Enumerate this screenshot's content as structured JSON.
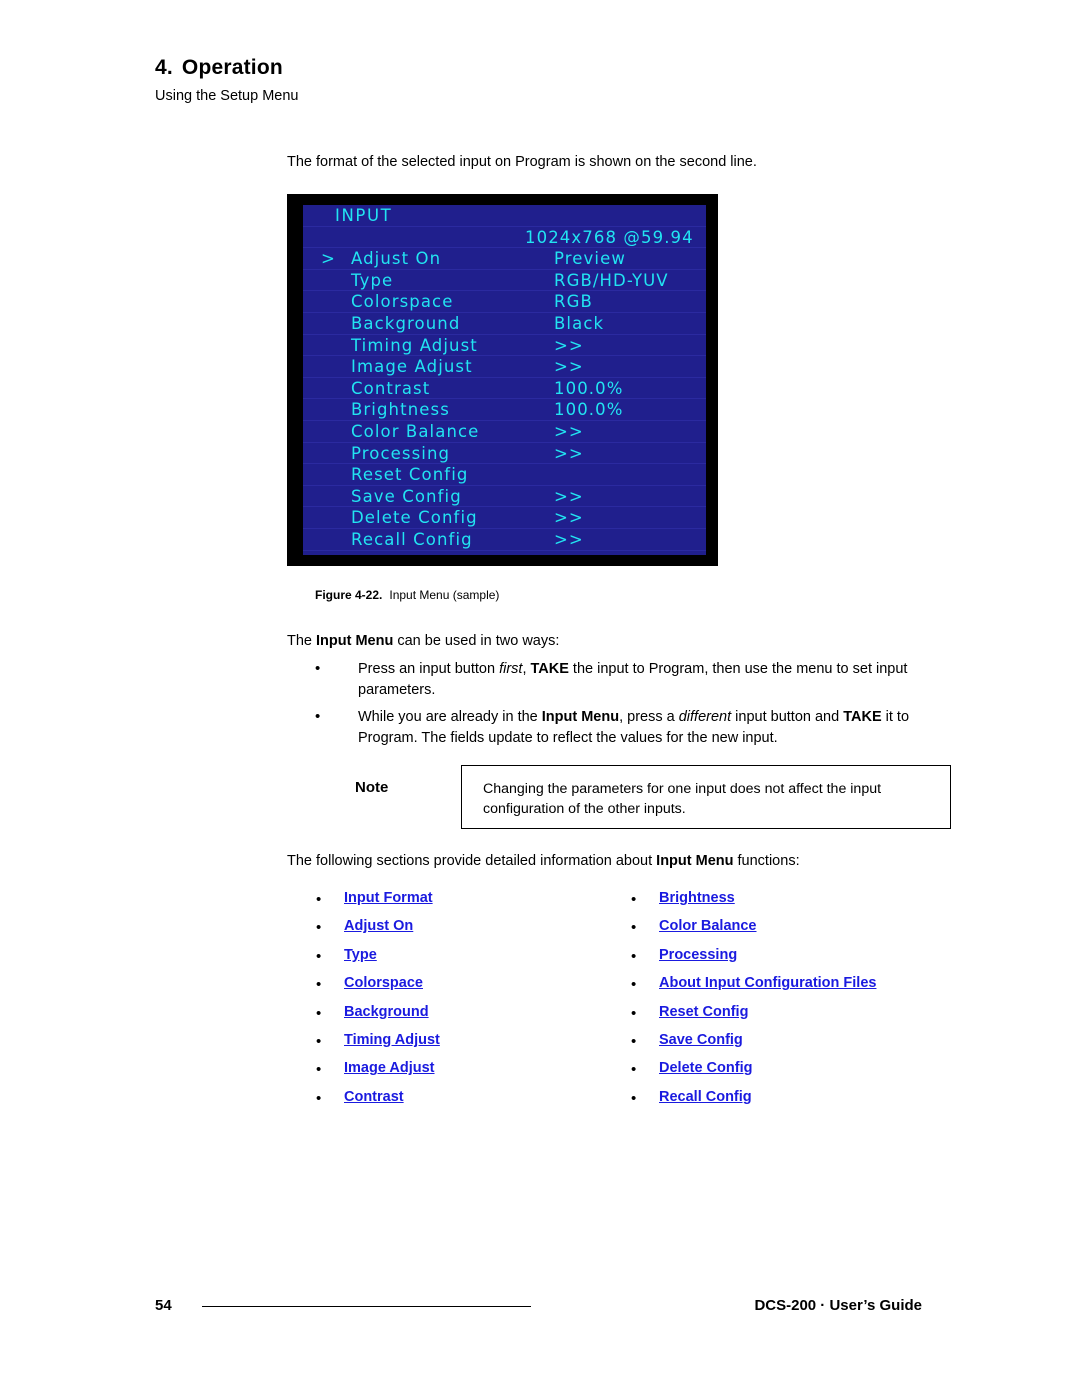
{
  "header": {
    "chapter_number": "4.",
    "chapter_title": "Operation",
    "subtitle": "Using the Setup Menu"
  },
  "intro_line": "The format of the selected input on Program is shown on the second line.",
  "lcd_menu": {
    "background_color": "#201f8d",
    "text_color": "#22e4f2",
    "border_color": "#000000",
    "rows": [
      {
        "cursor": "",
        "label": "INPUT",
        "value": "",
        "title": true
      },
      {
        "cursor": "",
        "label": "",
        "value": "1024x768 @59.94",
        "wide": true
      },
      {
        "cursor": ">",
        "label": "Adjust On",
        "value": "Preview"
      },
      {
        "cursor": "",
        "label": "Type",
        "value": "RGB/HD-YUV"
      },
      {
        "cursor": "",
        "label": "Colorspace",
        "value": "RGB"
      },
      {
        "cursor": "",
        "label": "Background",
        "value": "Black"
      },
      {
        "cursor": "",
        "label": "Timing Adjust",
        "value": ">>"
      },
      {
        "cursor": "",
        "label": "Image Adjust",
        "value": ">>"
      },
      {
        "cursor": "",
        "label": "Contrast",
        "value": "100.0%"
      },
      {
        "cursor": "",
        "label": "Brightness",
        "value": "100.0%"
      },
      {
        "cursor": "",
        "label": "Color Balance",
        "value": ">>"
      },
      {
        "cursor": "",
        "label": "Processing",
        "value": ">>"
      },
      {
        "cursor": "",
        "label": "Reset Config",
        "value": ""
      },
      {
        "cursor": "",
        "label": "Save Config",
        "value": ">>"
      },
      {
        "cursor": "",
        "label": "Delete Config",
        "value": ">>"
      },
      {
        "cursor": "",
        "label": "Recall Config",
        "value": ">>"
      }
    ]
  },
  "figure_caption": {
    "label": "Figure 4-22.",
    "text": "Input Menu (sample)"
  },
  "two_ways_line": {
    "pre": "The ",
    "bold": "Input Menu",
    "post": " can be used in two ways:"
  },
  "instructions": [
    {
      "bullet": "•",
      "segments": [
        {
          "text": "Press an input button ",
          "style": "normal"
        },
        {
          "text": "first",
          "style": "italic"
        },
        {
          "text": ", ",
          "style": "normal"
        },
        {
          "text": "TAKE",
          "style": "bold"
        },
        {
          "text": " the input to Program, then use the menu to set input parameters.",
          "style": "normal"
        }
      ]
    },
    {
      "bullet": "•",
      "segments": [
        {
          "text": "While you are already in the ",
          "style": "normal"
        },
        {
          "text": "Input Menu",
          "style": "bold"
        },
        {
          "text": ", press a ",
          "style": "normal"
        },
        {
          "text": "different",
          "style": "italic"
        },
        {
          "text": " input button and ",
          "style": "normal"
        },
        {
          "text": "TAKE",
          "style": "bold"
        },
        {
          "text": " it to Program.  The fields update to reflect the values for the new input.",
          "style": "normal"
        }
      ]
    }
  ],
  "note": {
    "label": "Note",
    "text": "Changing the parameters for one input does not affect the input configuration of the other inputs."
  },
  "following_line": {
    "pre": "The following sections provide detailed information about ",
    "bold": "Input Menu",
    "post": " functions:"
  },
  "links": {
    "color": "#1a1adf",
    "bullet": "•",
    "left": [
      "Input Format",
      "Adjust On",
      "Type",
      "Colorspace",
      "Background",
      "Timing Adjust",
      "Image Adjust",
      "Contrast"
    ],
    "right": [
      "Brightness",
      "Color Balance",
      "Processing",
      "About Input Configuration Files",
      "Reset Config",
      "Save Config",
      "Delete Config",
      "Recall Config"
    ]
  },
  "footer": {
    "page_number": "54",
    "guide": "DCS-200 · User’s Guide"
  }
}
